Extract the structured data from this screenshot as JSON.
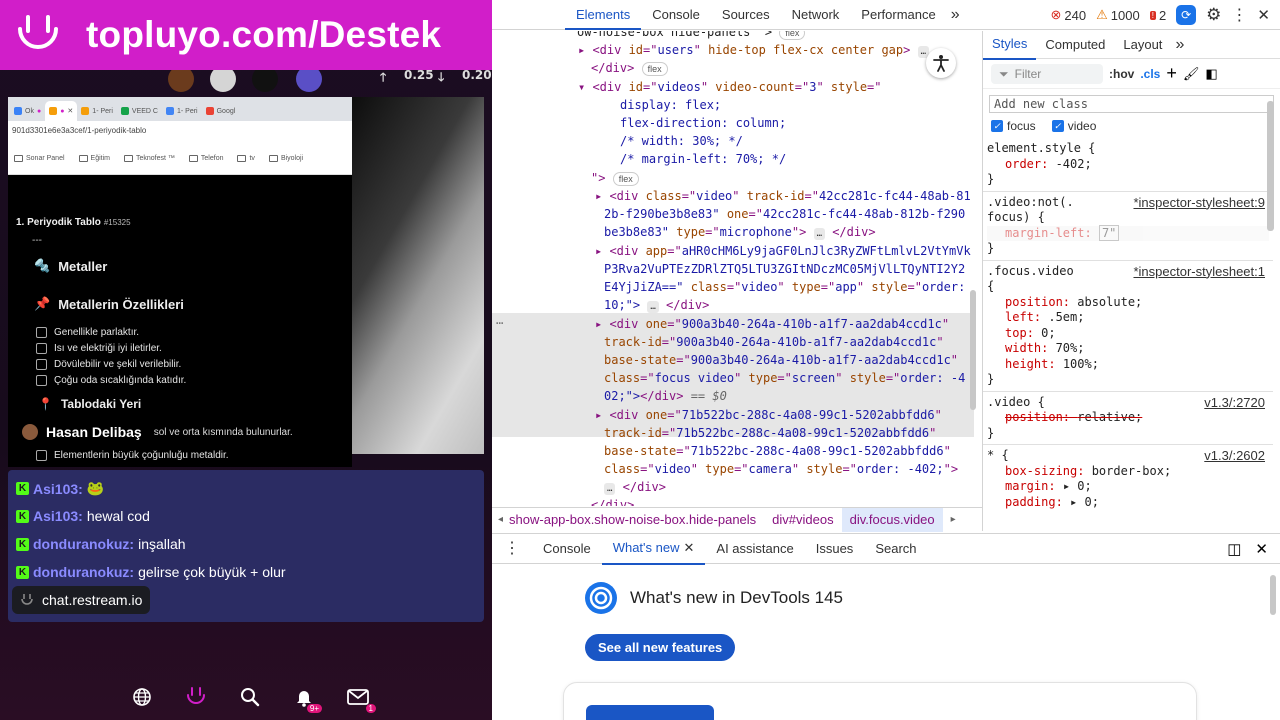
{
  "stream": {
    "banner_text": "topluyo.com/Destek",
    "upvotes": "0.25",
    "downvotes": "0.20",
    "browser": {
      "tabs": [
        "Ok",
        "",
        "",
        "1- Peri",
        "VEED C",
        "1- Peri",
        "Googl"
      ],
      "url": "901d3301e6e3a3cef/1-periyodik-tablo",
      "bookmarks": [
        "Sonar Panel",
        "Eğitim",
        "Teknofest ™",
        "Telefon",
        "tv",
        "Biyoloji"
      ],
      "page": {
        "title": "1. Periyodik Tablo",
        "title_id": "#15325",
        "dash": "---",
        "heading1": "Metaller",
        "heading2": "Metallerin Özellikleri",
        "items": [
          "Genellikle parlaktır.",
          "Isı ve elektriği iyi iletirler.",
          "Dövülebilir ve şekil verilebilir.",
          "Çoğu oda sıcaklığında katıdır."
        ],
        "heading3": "Tablodaki Yeri",
        "streamer_name": "Hasan Delibaş",
        "row_rest": "sol ve orta kısmında bulunurlar.",
        "item5": "Elementlerin büyük çoğunluğu metaldir."
      }
    },
    "chat": {
      "messages": [
        {
          "user": "Asi103:",
          "text": "🐸"
        },
        {
          "user": "Asi103:",
          "text": "hewal cod"
        },
        {
          "user": "donduranokuz:",
          "text": "inşallah"
        },
        {
          "user": "donduranokuz:",
          "text": "gelirse çok büyük + olur"
        }
      ],
      "source": "chat.restream.io",
      "badge_letter": "K"
    },
    "dock": {
      "notif_count": "9+",
      "mail_count": "1"
    },
    "colors": {
      "banner": "#d11ec9",
      "chat_bg": "#2b2c63",
      "chat_user": "#8a8bff",
      "kick_green": "#53fc18"
    }
  },
  "devtools": {
    "tabs": [
      "Elements",
      "Console",
      "Sources",
      "Network",
      "Performance"
    ],
    "more": "»",
    "errors": "240",
    "warnings": "1000",
    "issues": "2",
    "elements": {
      "lines": {
        "l0": "ow-noise-box hide-panels\" >",
        "l1a": "▸ <div ",
        "l1b": "id",
        "l1c": "=\"",
        "l1d": "users",
        "l1e": "\" ",
        "l1f": "hide-top flex-cx center gap",
        "l2": "</div>",
        "l3a": "▾ <div ",
        "l3b": "id",
        "l3c": "videos",
        "l3d": "video-count",
        "l3e": "3",
        "l3f": "style",
        "css1": "display: flex;",
        "css2": "flex-direction: column;",
        "css3": "/* width: 30%; */",
        "css4": "/* margin-left: 70%; */",
        "close1": "\">",
        "v1a": "class",
        "v1b": "video",
        "v1c": "track-id",
        "v1d": "42cc281c-fc44-48ab-81",
        "v1e": "2b-f290be3b8e83\"",
        "v1f": "one",
        "v1g": "42cc281c-fc44-48ab-812b-f290",
        "v1h": "be3b8e83\"",
        "v1i": "type",
        "v1j": "microphone",
        "v2a": "app",
        "v2b": "aHR0cHM6Ly9jaGF0LnJlc3RyZWFtLmlvL2VtYmVk",
        "v2c": "P3Rva2VuPTEzZDRlZTQ5LTU3ZGItNDczMC05MjVlLTQyNTI2Y2",
        "v2d": "E4YjJiZA==\"",
        "v2e": "class",
        "v2f": "video",
        "v2g": "type",
        "v2h": "app",
        "v2i": "style",
        "v2j": "order:",
        "v2k": "10;\">",
        "v3a": "one",
        "v3b": "900a3b40-264a-410b-a1f7-aa2dab4ccd1c",
        "v3c": "track-id",
        "v3d": "900a3b40-264a-410b-a1f7-aa2dab4ccd1c",
        "v3e": "base-state",
        "v3f": "900a3b40-264a-410b-a1f7-aa2dab4ccd1c",
        "v3g": "class",
        "v3h": "focus video",
        "v3i": "type",
        "v3j": "screen",
        "v3k": "style",
        "v3l": "order: -4",
        "v3m": "02;\">",
        "v3n": "== $0",
        "v4a": "one",
        "v4b": "71b522bc-288c-4a08-99c1-5202abbfdd6",
        "v4c": "track-id",
        "v4d": "71b522bc-288c-4a08-99c1-5202abbfdd6",
        "v4e": "base-state",
        "v4f": "71b522bc-288c-4a08-99c1-5202abbfdd6",
        "v4g": "class",
        "v4h": "video",
        "v4i": "type",
        "v4j": "camera",
        "v4k": "style",
        "v4l": "order: -402;",
        "end": "</div>"
      },
      "flex": "flex",
      "ellipsis": "…",
      "ellipsis_line": "⋯"
    },
    "breadcrumbs": [
      "show-app-box.show-noise-box.hide-panels",
      "div#videos",
      "div.focus.video"
    ],
    "styles": {
      "tabs": [
        "Styles",
        "Computed",
        "Layout"
      ],
      "filter_placeholder": "Filter",
      "hov": ":hov",
      "cls": ".cls",
      "add_class": "Add new class",
      "checks": [
        "focus",
        "video"
      ],
      "element_style": {
        "selector": "element.style {",
        "prop": "order",
        "value": "-402;"
      },
      "rule1": {
        "sel1": ".video:not(.",
        "sel2": "focus) {",
        "src": "*inspector-stylesheet:9",
        "prop": "margin-left",
        "value": "7\""
      },
      "rule2": {
        "sel": ".focus.video",
        "src": "*inspector-stylesheet:1",
        "open": "{",
        "props": [
          [
            "position",
            "absolute;"
          ],
          [
            "left",
            ".5em;"
          ],
          [
            "top",
            "0;"
          ],
          [
            "width",
            "70%;"
          ],
          [
            "height",
            "100%;"
          ]
        ]
      },
      "rule3": {
        "sel": ".video {",
        "src": "v1.3/:2720",
        "prop": "position",
        "value": "relative;"
      },
      "rule4": {
        "sel": "* {",
        "src": "v1.3/:2602",
        "props": [
          [
            "box-sizing",
            "border-box;"
          ],
          [
            "margin",
            "▸ 0;"
          ],
          [
            "padding",
            "▸ 0;"
          ]
        ]
      },
      "close": "}"
    },
    "drawer": {
      "tabs": [
        "Console",
        "What's new",
        "AI assistance",
        "Issues",
        "Search"
      ],
      "whats_new_title": "What's new in DevTools 145",
      "see_all": "See all new features"
    }
  }
}
